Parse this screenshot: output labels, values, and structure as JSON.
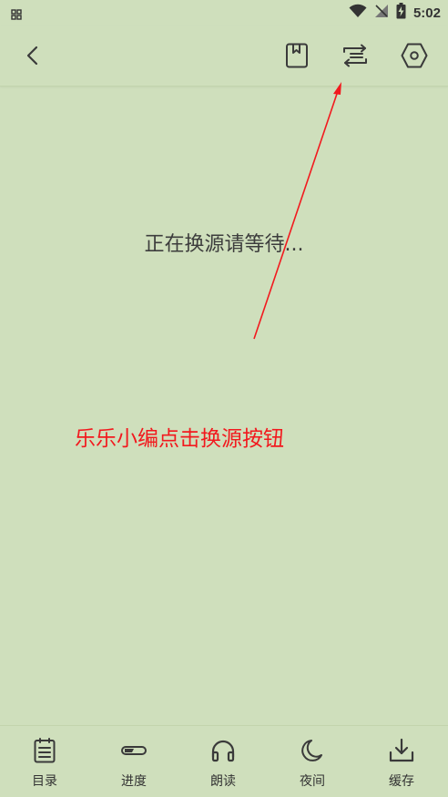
{
  "status_bar": {
    "time": "5:02"
  },
  "toolbar": {
    "back_icon": "chevron-left-icon",
    "bookmark_icon": "bookmark-icon",
    "change_source_icon": "change-source-icon",
    "settings_icon": "hexagon-settings-icon"
  },
  "content": {
    "loading_text": "正在换源请等待...",
    "annotation_text": "乐乐小编点击换源按钮",
    "annotation_color": "#f2191e",
    "background_color": "#cfdfbc"
  },
  "bottom_nav": [
    {
      "label": "目录",
      "icon": "catalog-icon"
    },
    {
      "label": "进度",
      "icon": "progress-icon"
    },
    {
      "label": "朗读",
      "icon": "headphones-icon"
    },
    {
      "label": "夜间",
      "icon": "moon-icon"
    },
    {
      "label": "缓存",
      "icon": "download-icon"
    }
  ]
}
